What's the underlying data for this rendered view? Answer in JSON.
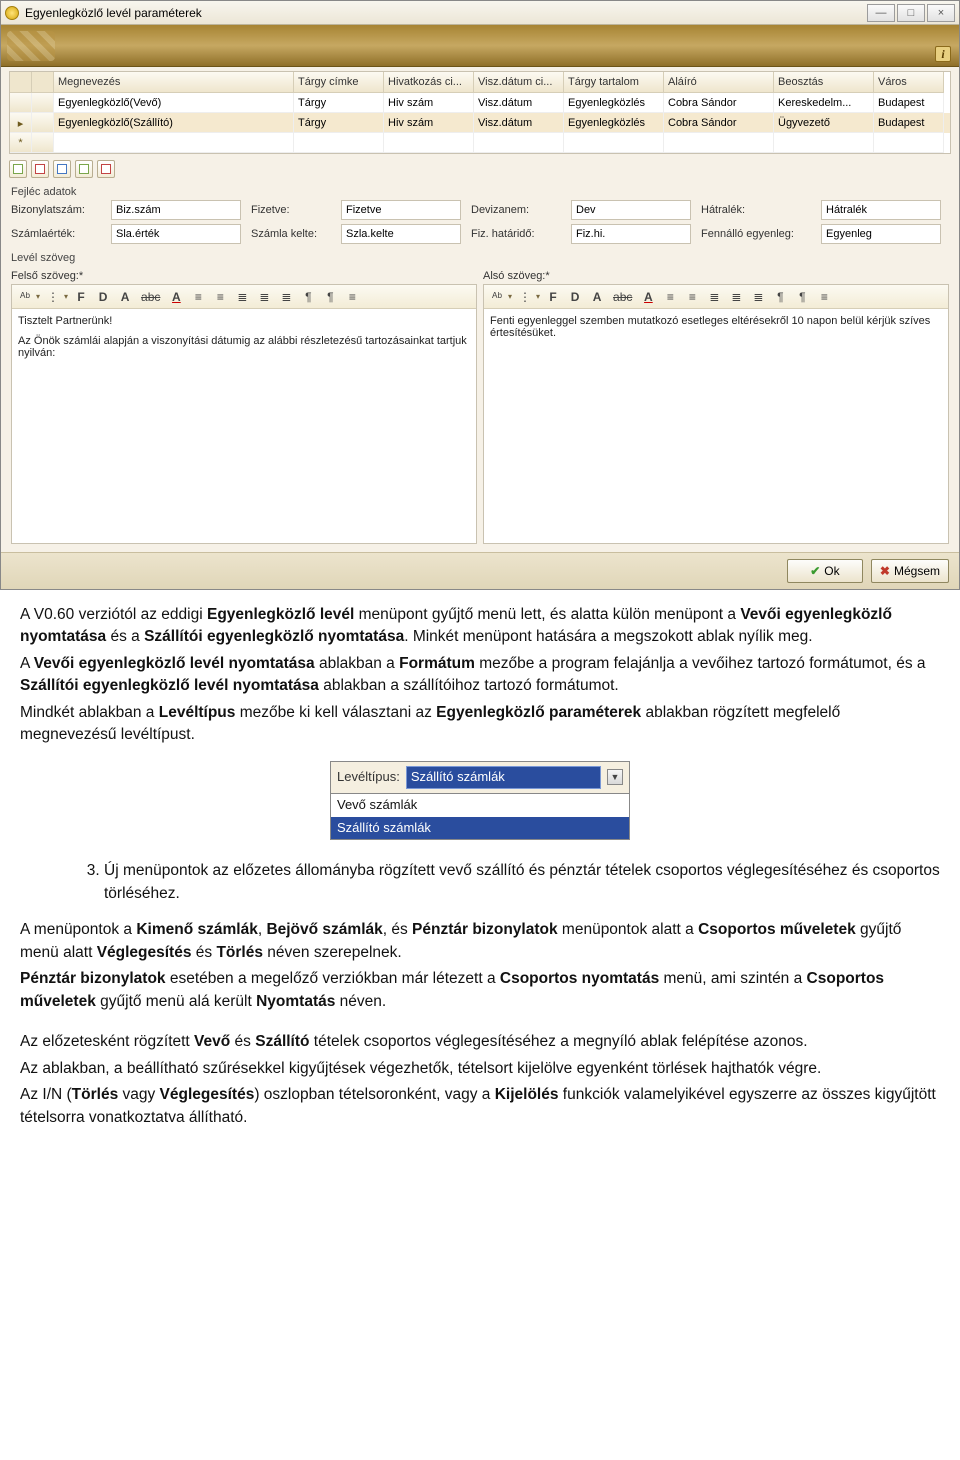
{
  "window": {
    "title": "Egyenlegközlő levél paraméterek",
    "buttons": {
      "min": "—",
      "max": "□",
      "close": "×"
    }
  },
  "grid": {
    "headers": [
      "",
      "",
      "Megnevezés",
      "Tárgy címke",
      "Hivatkozás ci...",
      "Visz.dátum ci...",
      "Tárgy tartalom",
      "Aláíró",
      "Beosztás",
      "Város"
    ],
    "rows": [
      [
        "",
        "",
        "Egyenlegközlő(Vevő)",
        "Tárgy",
        "Hiv szám",
        "Visz.dátum",
        "Egyenlegközlés",
        "Cobra Sándor",
        "Kereskedelm...",
        "Budapest"
      ],
      [
        "▸",
        "",
        "Egyenlegközlő(Szállító)",
        "Tárgy",
        "Hiv szám",
        "Visz.dátum",
        "Egyenlegközlés",
        "Cobra Sándor",
        "Ügyvezető",
        "Budapest"
      ],
      [
        "*",
        "",
        "",
        "",
        "",
        "",
        "",
        "",
        "",
        ""
      ]
    ]
  },
  "section_labels": {
    "header_data": "Fejléc adatok",
    "letter_text": "Levél szöveg"
  },
  "fields": {
    "f1l": "Bizonylatszám:",
    "f1v": "Biz.szám",
    "f2l": "Fizetve:",
    "f2v": "Fizetve",
    "f3l": "Devizanem:",
    "f3v": "Dev",
    "f4l": "Hátralék:",
    "f4v": "Hátralék",
    "f5l": "Számlaérték:",
    "f5v": "Sla.érték",
    "f6l": "Számla kelte:",
    "f6v": "Szla.kelte",
    "f7l": "Fiz. határidő:",
    "f7v": "Fiz.hi.",
    "f8l": "Fennálló egyenleg:",
    "f8v": "Egyenleg"
  },
  "editors": {
    "top_title": "Felső szöveg:*",
    "bottom_title": "Alsó szöveg:*",
    "toolbar_icons": [
      "ᴬᵇ",
      "⋮",
      "F",
      "D",
      "A",
      "abc",
      "A",
      "≡",
      "≡",
      "≣",
      "≣",
      "≣",
      "¶",
      "¶",
      "≡"
    ],
    "top_body_l1": "Tisztelt Partnerünk!",
    "top_body_l2": "Az Önök számlái alapján a viszonyítási dátumig az alábbi részletezésű tartozásainkat tartjuk nyilván:",
    "bottom_body": "Fenti egyenleggel szemben mutatkozó esetleges eltérésekről 10 napon belül kérjük szíves értesítésüket."
  },
  "footer": {
    "ok": "Ok",
    "cancel": "Mégsem"
  },
  "combo": {
    "label": "Levéltípus:",
    "selected": "Szállító számlák",
    "options": [
      "Vevő számlák",
      "Szállító számlák"
    ]
  },
  "doc": {
    "p1a": "A V0.60 verziótól az eddigi ",
    "p1b": "Egyenlegközlő levél",
    "p1c": " menüpont gyűjtő menü lett, és alatta külön menüpont a ",
    "p1d": "Vevői egyenlegközlő nyomtatása",
    "p1e": " és a ",
    "p1f": "Szállítói egyenlegközlő nyomtatása",
    "p1g": ". Minkét menüpont hatására a megszokott ablak nyílik meg.",
    "p2a": "A ",
    "p2b": "Vevői egyenlegközlő levél nyomtatása",
    "p2c": " ablakban a ",
    "p2d": "Formátum",
    "p2e": " mezőbe a program felajánlja a vevőihez tartozó formátumot, és a ",
    "p2f": "Szállítói egyenlegközlő levél nyomtatása",
    "p2g": " ablakban a szállítóihoz tartozó formátumot.",
    "p3a": "Mindkét ablakban a ",
    "p3b": "Levéltípus",
    "p3c": " mezőbe ki kell választani az ",
    "p3d": "Egyenlegközlő paraméterek",
    "p3e": " ablakban rögzített megfelelő megnevezésű levéltípust.",
    "li3": "Új menüpontok az előzetes állományba rögzített vevő szállító és pénztár tételek csoportos véglegesítéséhez és csoportos törléséhez.",
    "p4a": "A menüpontok a ",
    "p4b": "Kimenő számlák",
    "p4c": ", ",
    "p4d": "Bejövő számlák",
    "p4e": ", és ",
    "p4f": "Pénztár bizonylatok",
    "p4g": " menüpontok alatt a ",
    "p4h": "Csoportos műveletek",
    "p4i": " gyűjtő menü alatt ",
    "p4j": "Véglegesítés",
    "p4k": " és ",
    "p4l": "Törlés",
    "p4m": " néven szerepelnek.",
    "p5a": "Pénztár bizonylatok",
    "p5b": " esetében a megelőző verziókban már létezett a ",
    "p5c": "Csoportos nyomtatás",
    "p5d": " menü, ami szintén a ",
    "p5e": "Csoportos műveletek",
    "p5f": " gyűjtő menü alá került ",
    "p5g": "Nyomtatás",
    "p5h": " néven.",
    "p6a": "Az előzetesként rögzített ",
    "p6b": "Vevő",
    "p6c": " és ",
    "p6d": "Szállító",
    "p6e": " tételek csoportos véglegesítéséhez a megnyíló ablak felépítése azonos.",
    "p7": "Az ablakban, a beállítható szűrésekkel kigyűjtések végezhetők, tételsort kijelölve egyenként törlések hajthatók végre.",
    "p8a": "Az I/N (",
    "p8b": "Törlés",
    "p8c": " vagy ",
    "p8d": "Véglegesítés",
    "p8e": ") oszlopban tételsoronként, vagy a ",
    "p8f": "Kijelölés",
    "p8g": " funkciók valamelyikével egyszerre az összes kigyűjtött tételsorra vonatkoztatva állítható."
  }
}
